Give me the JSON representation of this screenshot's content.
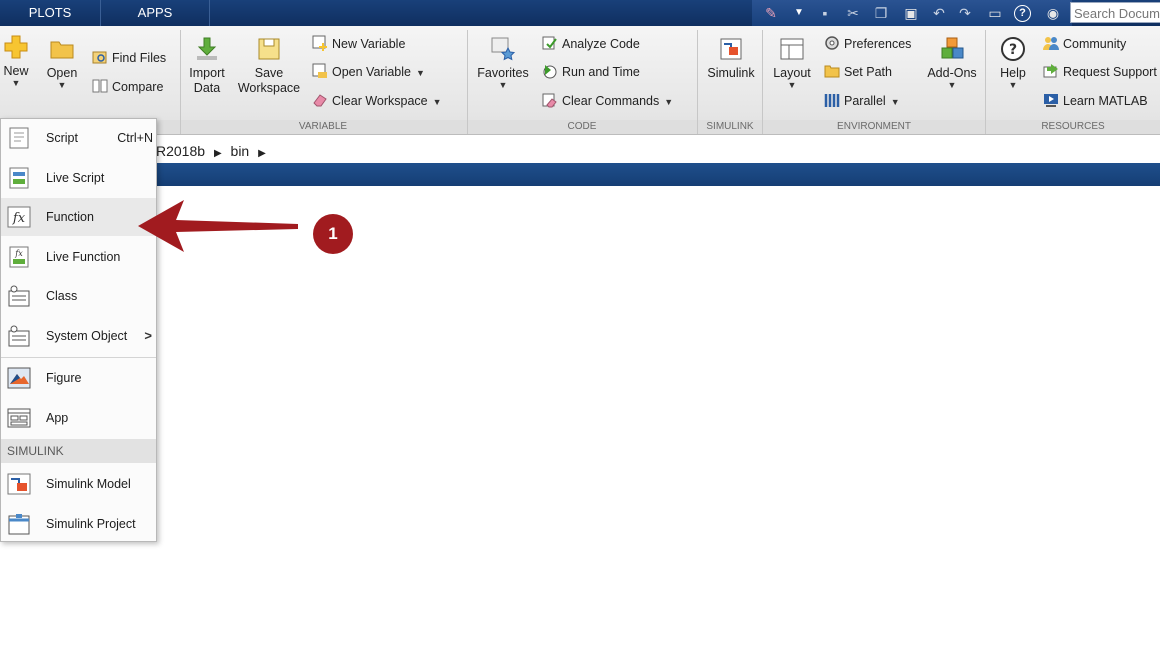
{
  "tabs": [
    {
      "label": "PLOTS"
    },
    {
      "label": "APPS"
    }
  ],
  "search": {
    "placeholder": "Search Documentation"
  },
  "ribbon": {
    "file": {
      "new": "New",
      "open": "Open",
      "find_files": "Find Files",
      "compare": "Compare"
    },
    "variable": {
      "import_data": "Import Data",
      "save_workspace": "Save Workspace",
      "new_variable": "New Variable",
      "open_variable": "Open Variable",
      "clear_workspace": "Clear Workspace",
      "section": "VARIABLE"
    },
    "code": {
      "favorites": "Favorites",
      "analyze_code": "Analyze Code",
      "run_and_time": "Run and Time",
      "clear_commands": "Clear Commands",
      "section": "CODE"
    },
    "simulink": {
      "simulink": "Simulink",
      "section": "SIMULINK"
    },
    "environment": {
      "layout": "Layout",
      "preferences": "Preferences",
      "set_path": "Set Path",
      "parallel": "Parallel",
      "add_ons": "Add-Ons",
      "section": "ENVIRONMENT"
    },
    "resources": {
      "help": "Help",
      "community": "Community",
      "request_support": "Request Support",
      "learn_matlab": "Learn MATLAB",
      "section": "RESOURCES"
    }
  },
  "address": {
    "path_part1": "R2018b",
    "path_part2": "bin"
  },
  "new_menu": {
    "items": [
      {
        "label": "Script",
        "shortcut": "Ctrl+N"
      },
      {
        "label": "Live Script"
      },
      {
        "label": "Function"
      },
      {
        "label": "Live Function"
      },
      {
        "label": "Class"
      },
      {
        "label": "System Object"
      },
      {
        "label": "Figure"
      },
      {
        "label": "App"
      }
    ],
    "simulink_header": "SIMULINK",
    "simulink_items": [
      {
        "label": "Simulink Model"
      },
      {
        "label": "Simulink Project"
      }
    ]
  },
  "annotation": {
    "step": "1"
  },
  "colors": {
    "accent": "#a11b1f",
    "tabbar": "#19407a",
    "bluebar": "#1f4f8c"
  }
}
